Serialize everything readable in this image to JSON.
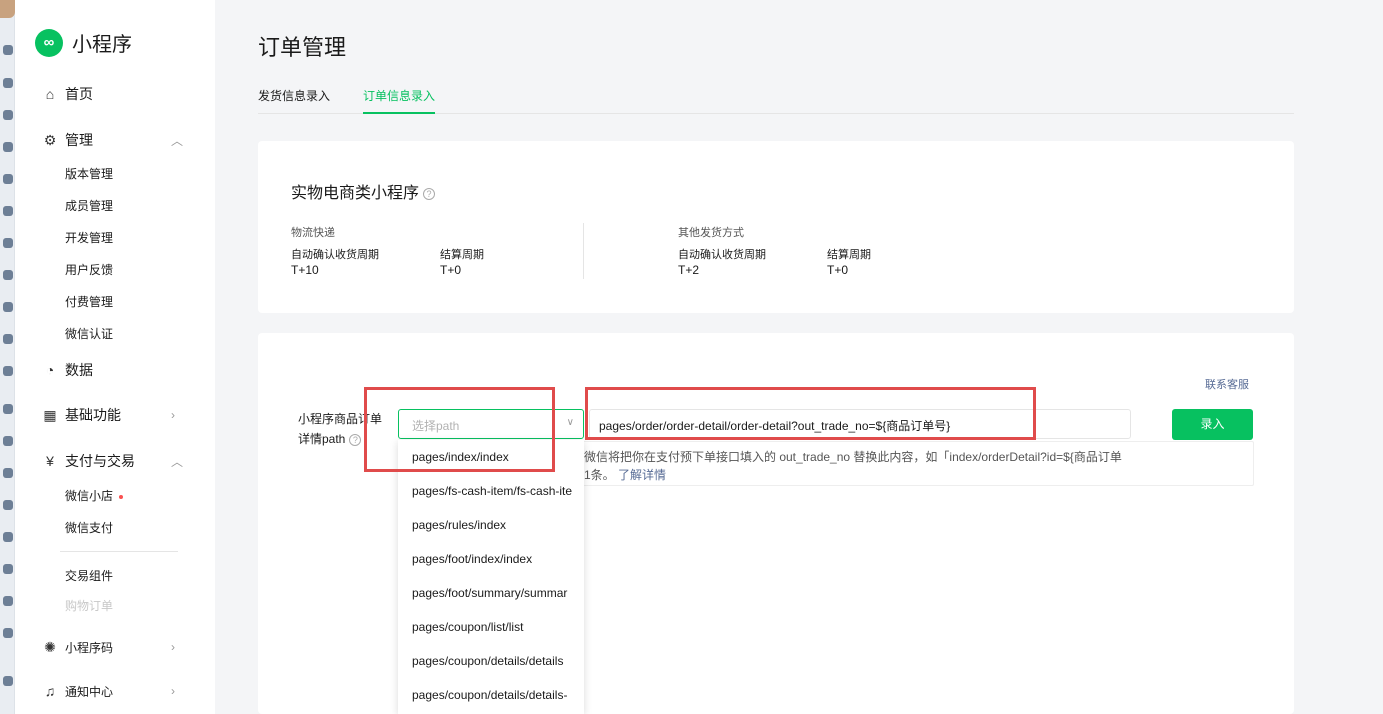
{
  "app": {
    "name": "小程序"
  },
  "sidebar": {
    "items": [
      {
        "icon": "home-icon",
        "label": "首页"
      },
      {
        "icon": "gear-icon",
        "label": "管理",
        "expanded": true
      },
      {
        "icon": "chart-icon",
        "label": "数据"
      },
      {
        "icon": "grid-icon",
        "label": "基础功能"
      },
      {
        "icon": "money-icon",
        "label": "支付与交易",
        "expanded": true
      },
      {
        "icon": "qrcode-icon",
        "label": "小程序码"
      },
      {
        "icon": "bell-icon",
        "label": "通知中心"
      }
    ],
    "manage_sub": [
      "版本管理",
      "成员管理",
      "开发管理",
      "用户反馈",
      "付费管理",
      "微信认证"
    ],
    "pay_sub": [
      "微信小店",
      "微信支付",
      "交易组件",
      "购物订单"
    ]
  },
  "page": {
    "title": "订单管理"
  },
  "tabs": [
    {
      "label": "发货信息录入",
      "active": false
    },
    {
      "label": "订单信息录入",
      "active": true
    }
  ],
  "summary": {
    "title": "实物电商类小程序",
    "groups": [
      {
        "title": "物流快递",
        "auto_label": "自动确认收货周期",
        "auto_value": "T+10",
        "settle_label": "结算周期",
        "settle_value": "T+0"
      },
      {
        "title": "其他发货方式",
        "auto_label": "自动确认收货周期",
        "auto_value": "T+2",
        "settle_label": "结算周期",
        "settle_value": "T+0"
      }
    ]
  },
  "form": {
    "contact": "联系客服",
    "label": "小程序商品订单详情path",
    "select_placeholder": "选择path",
    "path_value": "pages/order/order-detail/order-detail?out_trade_no=${商品订单号}",
    "submit": "录入",
    "hint_line1": "微信将把你在支付预下单接口填入的 out_trade_no 替换此内容，如「index/orderDetail?id=${商品订单",
    "hint_line2": "1条。",
    "hint_link": "了解详情"
  },
  "dropdown": {
    "options": [
      "pages/index/index",
      "pages/fs-cash-item/fs-cash-ite",
      "pages/rules/index",
      "pages/foot/index/index",
      "pages/foot/summary/summar",
      "pages/coupon/list/list",
      "pages/coupon/details/details",
      "pages/coupon/details/details-"
    ]
  },
  "colors": {
    "accent": "#07c160",
    "highlight": "#e04b4b",
    "link": "#576b95"
  }
}
